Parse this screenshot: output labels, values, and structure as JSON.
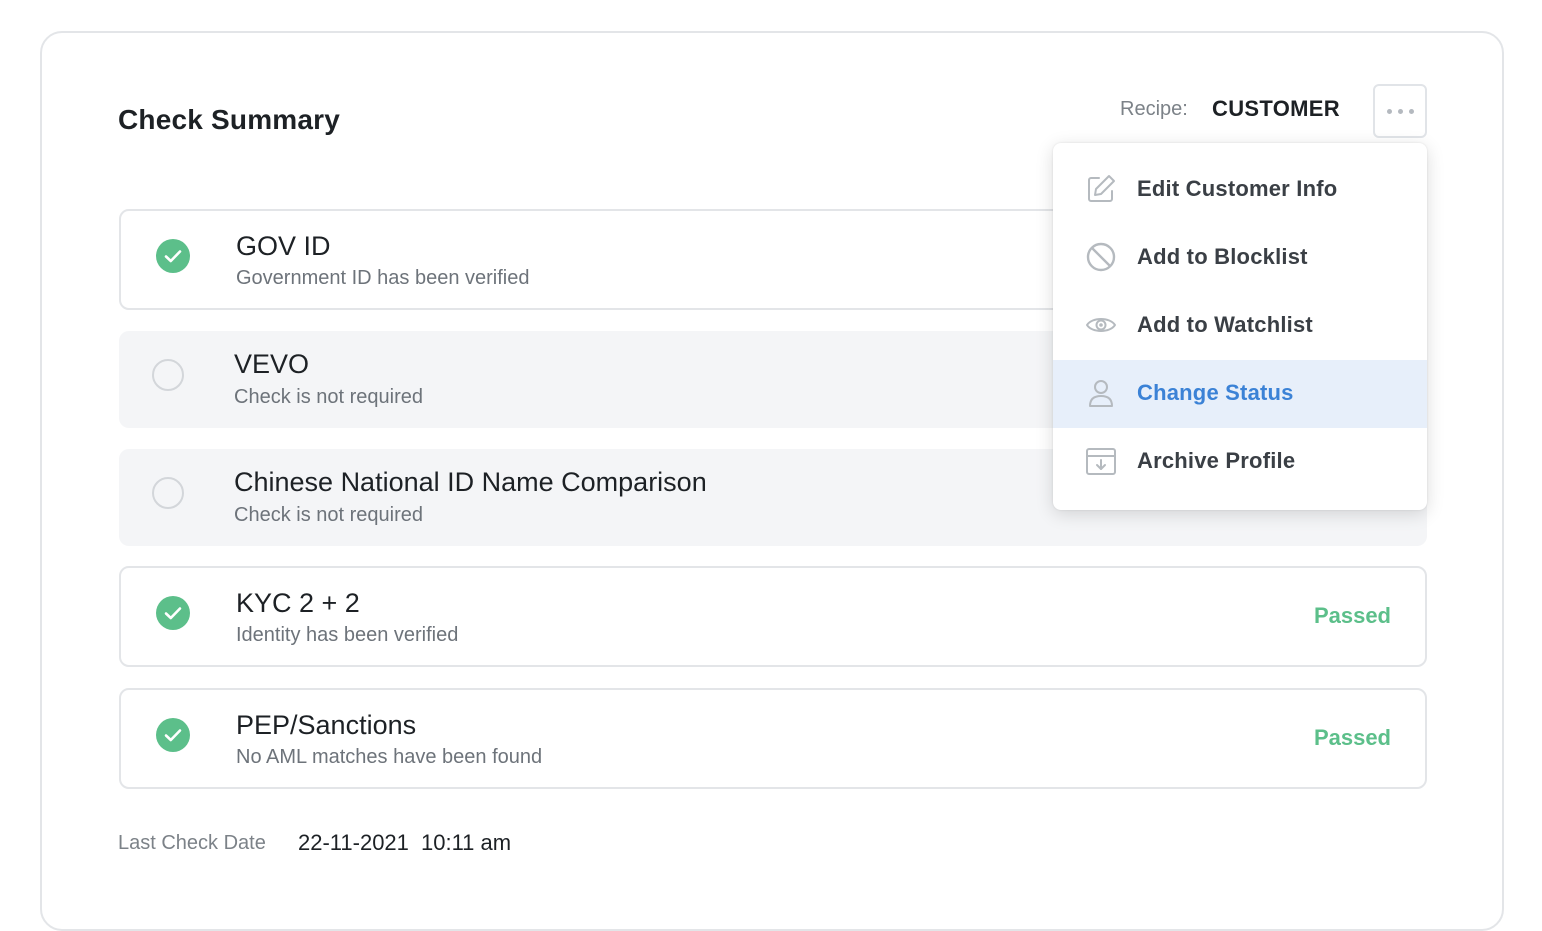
{
  "header": {
    "title": "Check Summary",
    "recipe_label": "Recipe:",
    "recipe_value": "CUSTOMER",
    "more_button_icon": "more-horizontal-icon"
  },
  "checks": [
    {
      "title": "GOV ID",
      "subtitle": "Government ID has been verified",
      "status": "passed",
      "status_label": ""
    },
    {
      "title": "VEVO",
      "subtitle": "Check is not required",
      "status": "not_required",
      "status_label": ""
    },
    {
      "title": "Chinese National ID Name Comparison",
      "subtitle": "Check is not required",
      "status": "not_required",
      "status_label": ""
    },
    {
      "title": "KYC 2 + 2",
      "subtitle": "Identity has been verified",
      "status": "passed",
      "status_label": "Passed"
    },
    {
      "title": "PEP/Sanctions",
      "subtitle": "No AML matches have been found",
      "status": "passed",
      "status_label": "Passed"
    }
  ],
  "footer": {
    "last_check_label": "Last Check Date",
    "date": "22-11-2021",
    "time": "10:11 am"
  },
  "menu": {
    "items": [
      {
        "label": "Edit Customer Info",
        "icon": "edit-icon",
        "active": false
      },
      {
        "label": "Add to Blocklist",
        "icon": "block-icon",
        "active": false
      },
      {
        "label": "Add to Watchlist",
        "icon": "eye-icon",
        "active": false
      },
      {
        "label": "Change Status",
        "icon": "user-icon",
        "active": true
      },
      {
        "label": "Archive Profile",
        "icon": "archive-icon",
        "active": false
      }
    ]
  },
  "colors": {
    "success": "#5cbf8a",
    "accent": "#3b82d6",
    "active_bg": "#e7effa",
    "border": "#e3e5e8"
  }
}
